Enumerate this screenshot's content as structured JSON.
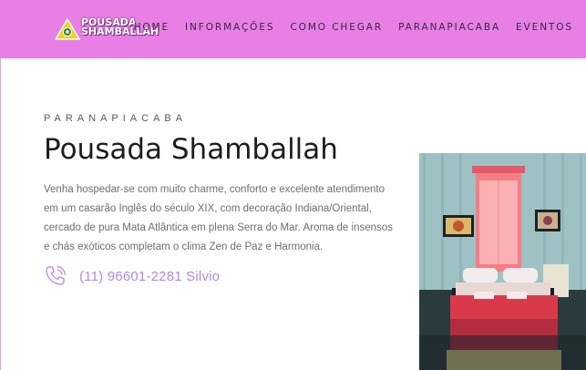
{
  "header": {
    "logo": {
      "line1": "POUSADA",
      "line2": "SHAMBALLAH"
    },
    "nav": [
      "HOME",
      "INFORMAÇÕES",
      "COMO CHEGAR",
      "PARANAPIACABA",
      "EVENTOS"
    ]
  },
  "hero": {
    "kicker": "PARANAPIACABA",
    "title": "Pousada Shamballah",
    "description": "Venha hospedar-se com muito charme, conforto e excelente atendimento em um casarão Inglês do século XIX, com decoração Indiana/Oriental, cercado de pura Mata Atlântica em plena Serra do Mar. Aroma de insensos e chás exóticos completam o clima Zen de Paz e Harmonia.",
    "phone": "(11) 96601-2281 Silvio",
    "phone_icon": "phone-icon"
  },
  "colors": {
    "header_bg": "#e77fe5",
    "accent": "#b487e6",
    "title": "#1d1d1d",
    "body_text": "#6e6e6e"
  }
}
